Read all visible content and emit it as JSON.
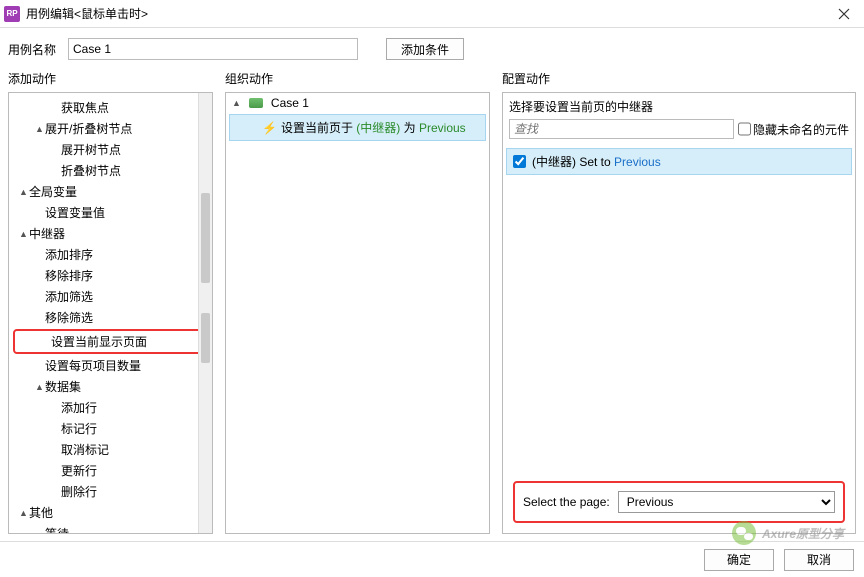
{
  "window": {
    "title": "用例编辑<鼠标单击时>",
    "logo_text": "RP"
  },
  "toprow": {
    "name_label": "用例名称",
    "name_value": "Case 1",
    "add_condition": "添加条件"
  },
  "columns": {
    "left_header": "添加动作",
    "mid_header": "组织动作",
    "right_header": "配置动作"
  },
  "tree": [
    {
      "level": 2,
      "label": "获取焦点",
      "arrow": ""
    },
    {
      "level": 1,
      "label": "展开/折叠树节点",
      "arrow": "▲"
    },
    {
      "level": 2,
      "label": "展开树节点",
      "arrow": ""
    },
    {
      "level": 2,
      "label": "折叠树节点",
      "arrow": ""
    },
    {
      "level": 0,
      "label": "全局变量",
      "arrow": "▲"
    },
    {
      "level": 1,
      "label": "设置变量值",
      "arrow": ""
    },
    {
      "level": 0,
      "label": "中继器",
      "arrow": "▲"
    },
    {
      "level": 1,
      "label": "添加排序",
      "arrow": ""
    },
    {
      "level": 1,
      "label": "移除排序",
      "arrow": ""
    },
    {
      "level": 1,
      "label": "添加筛选",
      "arrow": ""
    },
    {
      "level": 1,
      "label": "移除筛选",
      "arrow": ""
    },
    {
      "level": 1,
      "label": "设置当前显示页面",
      "arrow": "",
      "highlight": true
    },
    {
      "level": 1,
      "label": "设置每页项目数量",
      "arrow": ""
    },
    {
      "level": 1,
      "label": "数据集",
      "arrow": "▲"
    },
    {
      "level": 2,
      "label": "添加行",
      "arrow": ""
    },
    {
      "level": 2,
      "label": "标记行",
      "arrow": ""
    },
    {
      "level": 2,
      "label": "取消标记",
      "arrow": ""
    },
    {
      "level": 2,
      "label": "更新行",
      "arrow": ""
    },
    {
      "level": 2,
      "label": "删除行",
      "arrow": ""
    },
    {
      "level": 0,
      "label": "其他",
      "arrow": "▲"
    },
    {
      "level": 1,
      "label": "等待",
      "arrow": ""
    }
  ],
  "mid": {
    "case_label": "Case 1",
    "action_prefix": "设置当前页于",
    "action_target": " (中继器) ",
    "action_mid": "为",
    "action_value": " Previous"
  },
  "right": {
    "instruction": "选择要设置当前页的中继器",
    "search_placeholder": "查找",
    "hide_unnamed": "隐藏未命名的元件",
    "target_text": "(中继器) Set to ",
    "target_value": "Previous",
    "select_page_label": "Select the page:",
    "select_page_value": "Previous"
  },
  "footer": {
    "ok": "确定",
    "cancel": "取消"
  },
  "watermark": "Axure原型分享"
}
